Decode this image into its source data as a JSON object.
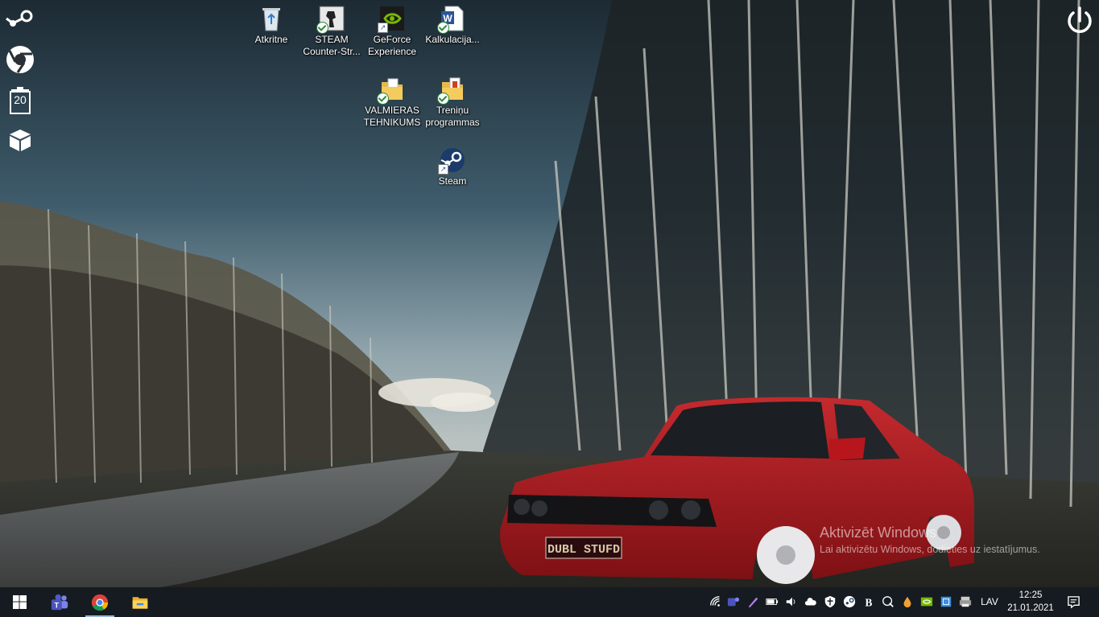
{
  "desktop": {
    "icons": [
      {
        "label": "Atkritne",
        "icon": "recycle-bin-icon"
      },
      {
        "label": "STEAM\nCounter-Str...",
        "icon": "counter-strike-icon"
      },
      {
        "label": "GeForce\nExperience",
        "icon": "geforce-icon"
      },
      {
        "label": "Kalkulacija...",
        "icon": "word-document-icon"
      },
      {
        "label": "VALMIERAS\nTEHNIKUMS",
        "icon": "folder-icon"
      },
      {
        "label": "Treniņu\nprogrammas",
        "icon": "document-folder-icon"
      },
      {
        "label": "Steam",
        "icon": "steam-icon"
      }
    ]
  },
  "dock": {
    "items": [
      {
        "icon": "steam-icon"
      },
      {
        "icon": "chrome-icon"
      },
      {
        "icon": "trash-icon",
        "count": "20"
      },
      {
        "icon": "box-icon"
      }
    ]
  },
  "wallpaper": {
    "license_plate": "DUBL STUFD"
  },
  "watermark": {
    "title": "Aktivizēt Windows",
    "subtitle": "Lai aktivizētu Windows, dodieties uz iestatījumus."
  },
  "taskbar": {
    "pinned": [
      {
        "icon": "windows-start-icon"
      },
      {
        "icon": "teams-icon"
      },
      {
        "icon": "chrome-icon"
      },
      {
        "icon": "file-explorer-icon"
      }
    ],
    "tray": [
      "wifi-icon",
      "teams-tray-icon",
      "pen-icon",
      "battery-icon",
      "volume-icon",
      "cloud-icon",
      "defender-icon",
      "steam-tray-icon",
      "app-b-icon",
      "disk-icon",
      "drop-icon",
      "nvidia-icon",
      "network-icon",
      "printer-icon"
    ],
    "language": "LAV",
    "time": "12:25",
    "date": "21.01.2021"
  },
  "colors": {
    "sky": "#4b6d80",
    "car_red": "#b01a20",
    "taskbar": "#12161a"
  }
}
